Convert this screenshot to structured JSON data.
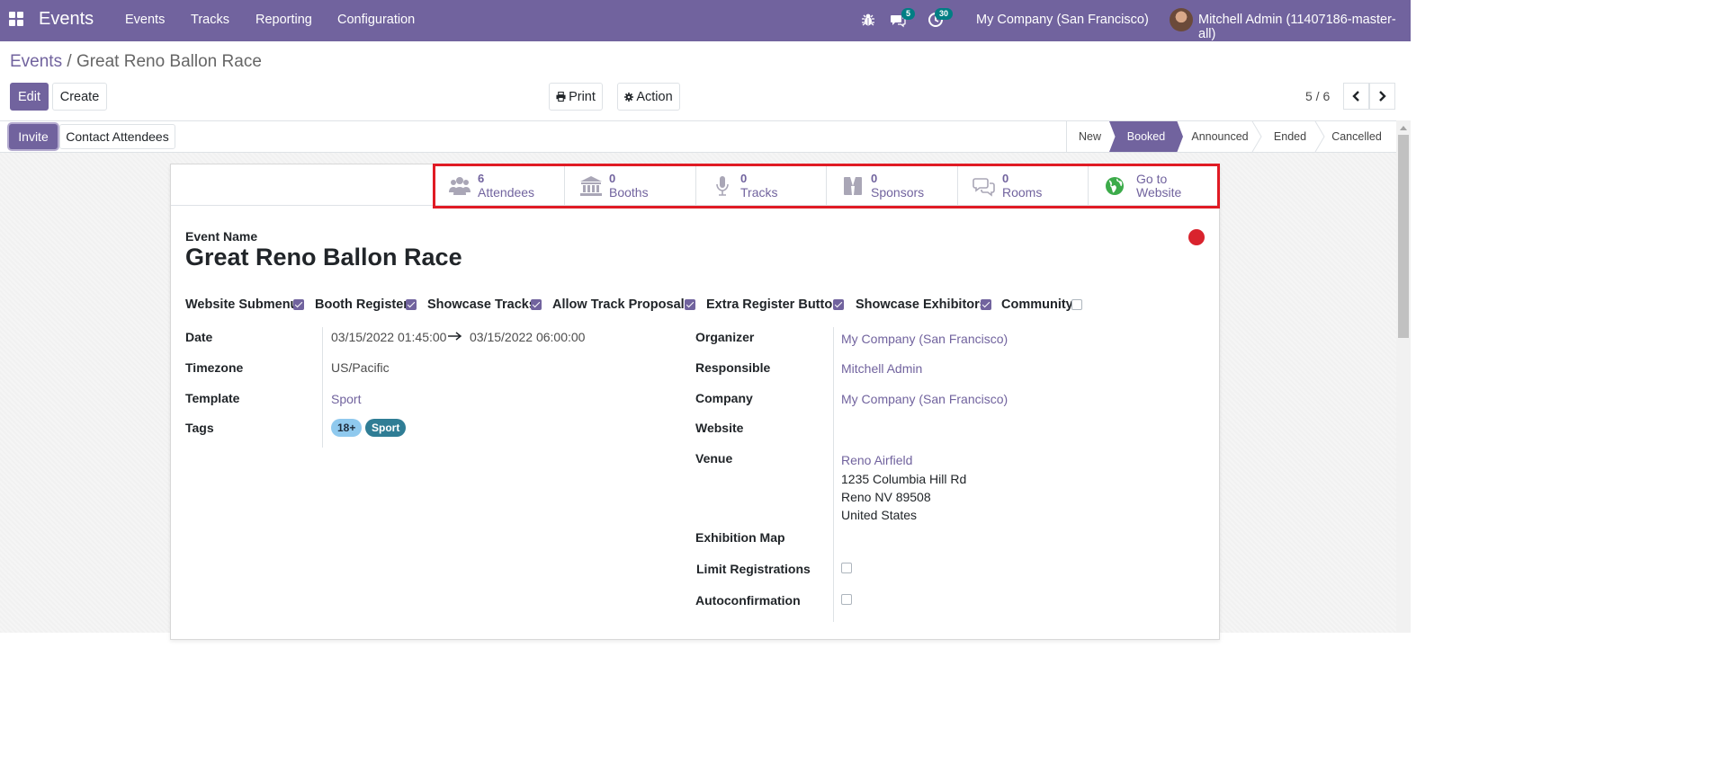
{
  "navbar": {
    "app_title": "Events",
    "menu": [
      "Events",
      "Tracks",
      "Reporting",
      "Configuration"
    ],
    "messages_count": "5",
    "activities_count": "30",
    "company": "My Company (San Francisco)",
    "user": "Mitchell Admin (11407186-master-all)",
    "color": "#71639e"
  },
  "breadcrumb": {
    "parent": "Events",
    "separator": "/",
    "current": "Great Reno Ballon Race"
  },
  "toolbar": {
    "edit": "Edit",
    "create": "Create",
    "print": "Print",
    "action": "Action"
  },
  "pager": {
    "value": "5 / 6"
  },
  "header_buttons": {
    "invite": "Invite",
    "contact": "Contact Attendees"
  },
  "stages": [
    {
      "label": "New",
      "active": false
    },
    {
      "label": "Booked",
      "active": true
    },
    {
      "label": "Announced",
      "active": false
    },
    {
      "label": "Ended",
      "active": false
    },
    {
      "label": "Cancelled",
      "active": false
    }
  ],
  "smart_buttons": [
    {
      "icon": "users-icon",
      "value": "6",
      "label": "Attendees"
    },
    {
      "icon": "bank-icon",
      "value": "0",
      "label": "Booths"
    },
    {
      "icon": "microphone-icon",
      "value": "0",
      "label": "Tracks"
    },
    {
      "icon": "sponsor-icon",
      "value": "0",
      "label": "Sponsors"
    },
    {
      "icon": "comments-icon",
      "value": "0",
      "label": "Rooms"
    },
    {
      "icon": "globe-icon",
      "line1": "Go to",
      "line2": "Website"
    }
  ],
  "form": {
    "name_label": "Event Name",
    "name": "Great Reno Ballon Race",
    "options": [
      {
        "label": "Website Submenu",
        "checked": true
      },
      {
        "label": "Booth Register",
        "checked": true
      },
      {
        "label": "Showcase Tracks",
        "checked": true
      },
      {
        "label": "Allow Track Proposals",
        "checked": true
      },
      {
        "label": "Extra Register Button",
        "checked": true
      },
      {
        "label": "Showcase Exhibitors",
        "checked": true
      },
      {
        "label": "Community",
        "checked": false
      }
    ],
    "left": {
      "date_label": "Date",
      "date_begin": "03/15/2022 01:45:00",
      "date_end": "03/15/2022 06:00:00",
      "timezone_label": "Timezone",
      "timezone": "US/Pacific",
      "template_label": "Template",
      "template": "Sport",
      "tags_label": "Tags",
      "tags": [
        {
          "name": "18+",
          "bg": "#8fc9ee",
          "fg": "#1f2d3d"
        },
        {
          "name": "Sport",
          "bg": "#2f7d95",
          "fg": "#ffffff"
        }
      ]
    },
    "right": {
      "organizer_label": "Organizer",
      "organizer": "My Company (San Francisco)",
      "responsible_label": "Responsible",
      "responsible": "Mitchell Admin",
      "company_label": "Company",
      "company": "My Company (San Francisco)",
      "website_label": "Website",
      "website": "",
      "venue_label": "Venue",
      "venue_name": "Reno Airfield",
      "venue_street": "1235 Columbia Hill Rd",
      "venue_city": "Reno NV 89508",
      "venue_country": "United States",
      "exhibition_map_label": "Exhibition Map",
      "limit_label": "Limit Registrations",
      "limit": false,
      "autoconfirm_label": "Autoconfirmation",
      "autoconfirm": false
    }
  },
  "colors": {
    "primary": "#71639e",
    "kanban_state": "#d9232d",
    "highlight_box": "#e01b24"
  }
}
